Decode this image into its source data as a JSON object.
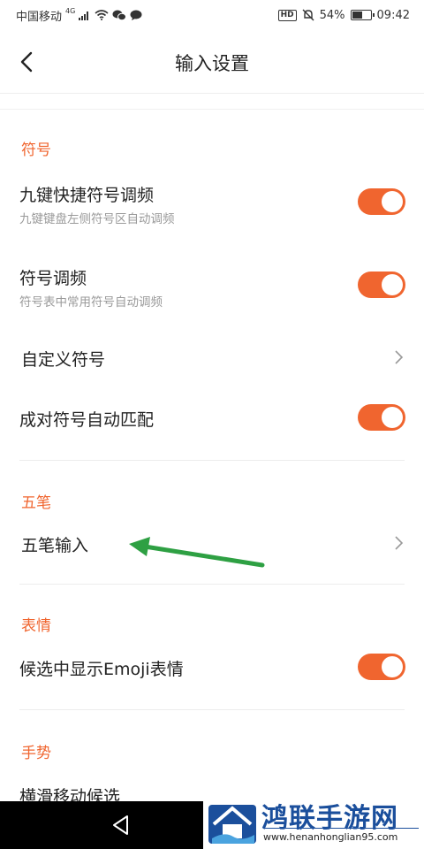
{
  "status_bar": {
    "carrier": "中国移动",
    "network": "4G",
    "hd": "HD",
    "battery": "54%",
    "battery_level": 0.54,
    "time": "09:42"
  },
  "header": {
    "title": "输入设置"
  },
  "sections": {
    "symbols": {
      "label": "符号",
      "items": [
        {
          "title": "九键快捷符号调频",
          "subtitle": "九键键盘左侧符号区自动调频",
          "control": "toggle",
          "on": true
        },
        {
          "title": "符号调频",
          "subtitle": "符号表中常用符号自动调频",
          "control": "toggle",
          "on": true
        },
        {
          "title": "自定义符号",
          "control": "chevron"
        },
        {
          "title": "成对符号自动匹配",
          "control": "toggle",
          "on": true
        }
      ]
    },
    "wubi": {
      "label": "五笔",
      "items": [
        {
          "title": "五笔输入",
          "control": "chevron"
        }
      ]
    },
    "emoji": {
      "label": "表情",
      "items": [
        {
          "title": "候选中显示Emoji表情",
          "control": "toggle",
          "on": true
        }
      ]
    },
    "gesture": {
      "label": "手势",
      "items": [
        {
          "title": "横滑移动候选"
        }
      ]
    }
  },
  "colors": {
    "accent": "#f0652f",
    "watermark_blue": "#1b4f9c",
    "annotation_green": "#2ea043"
  },
  "icons": {
    "back": "chevron-left-icon",
    "row_arrow": "chevron-right-icon",
    "nav_back": "triangle-back-icon"
  },
  "watermark": {
    "name": "鸿联手游网",
    "url": "www.henanhonglian95.com"
  }
}
